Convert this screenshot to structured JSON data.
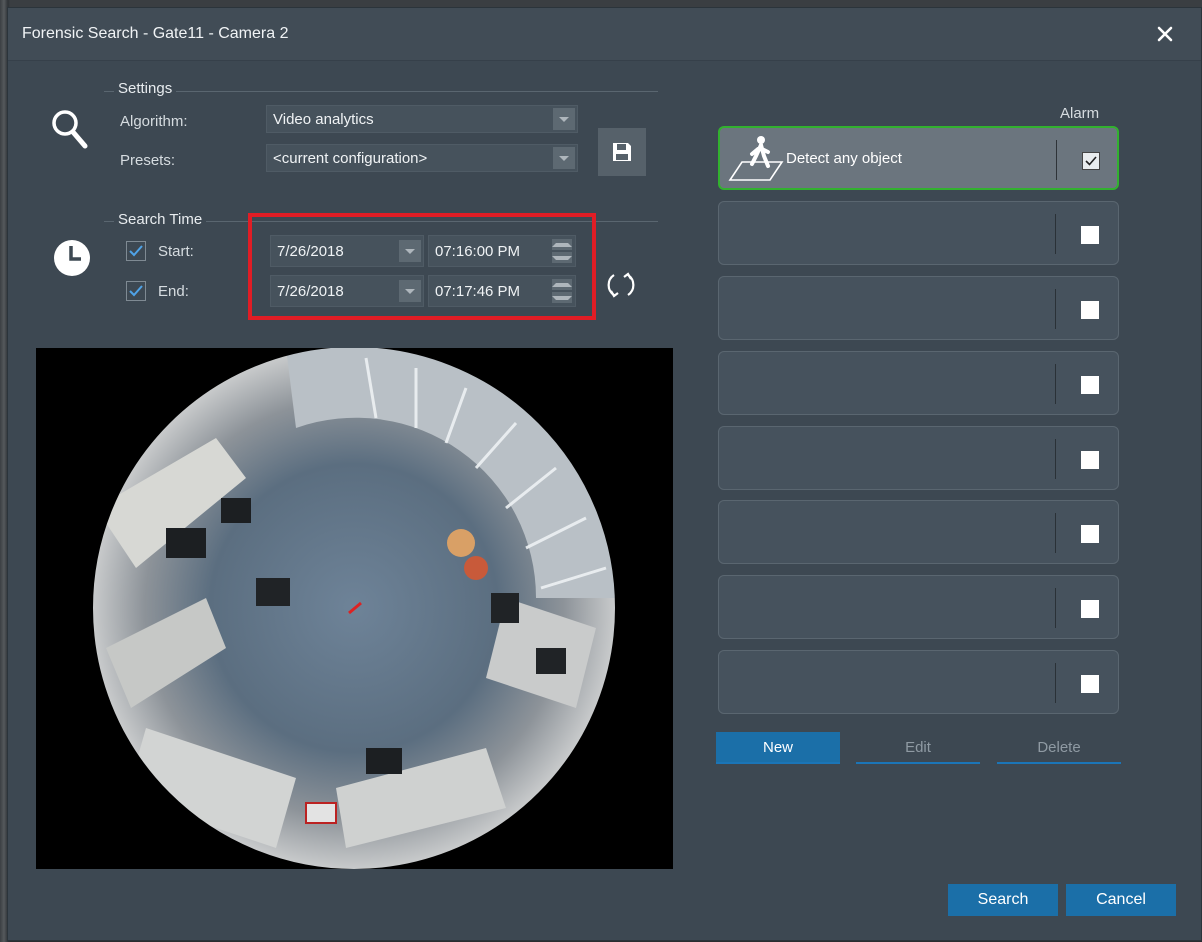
{
  "window": {
    "title": "Forensic Search - Gate11 - Camera 2"
  },
  "settings": {
    "group_label": "Settings",
    "algorithm_label": "Algorithm:",
    "algorithm_value": "Video analytics",
    "presets_label": "Presets:",
    "presets_value": "<current configuration>"
  },
  "search_time": {
    "group_label": "Search Time",
    "start_label": "Start:",
    "start_checked": true,
    "start_date": "7/26/2018",
    "start_time": "07:16:00 PM",
    "end_label": "End:",
    "end_checked": true,
    "end_date": "7/26/2018",
    "end_time": "07:17:46 PM"
  },
  "rules": {
    "alarm_header": "Alarm",
    "items": [
      {
        "label": "Detect any object",
        "alarm": true,
        "selected": true
      },
      {
        "label": "",
        "alarm": false
      },
      {
        "label": "",
        "alarm": false
      },
      {
        "label": "",
        "alarm": false
      },
      {
        "label": "",
        "alarm": false
      },
      {
        "label": "",
        "alarm": false
      },
      {
        "label": "",
        "alarm": false
      },
      {
        "label": "",
        "alarm": false
      }
    ]
  },
  "rule_actions": {
    "new": "New",
    "edit": "Edit",
    "delete": "Delete"
  },
  "footer": {
    "search": "Search",
    "cancel": "Cancel"
  },
  "colors": {
    "accent": "#1b6fa8",
    "selected_border": "#32b12f",
    "highlight_box": "#e11d25"
  }
}
